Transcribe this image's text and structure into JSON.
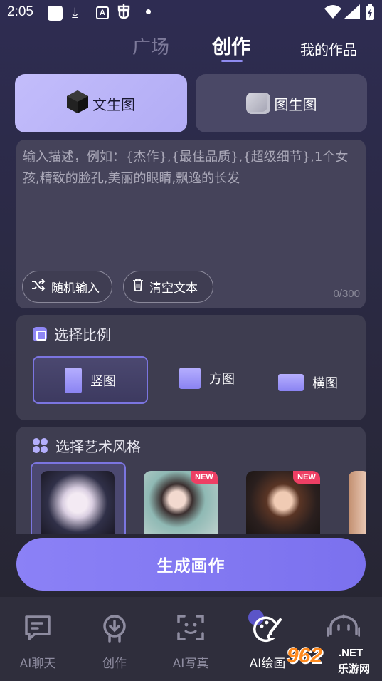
{
  "status_bar": {
    "time": "2:05",
    "icons": [
      "notification-square-icon",
      "download-icon",
      "a-icon",
      "bug-icon",
      "dot-icon",
      "wifi-icon",
      "signal-icon",
      "battery-icon"
    ]
  },
  "top_tabs": {
    "items": [
      {
        "label": "广场",
        "active": false
      },
      {
        "label": "创作",
        "active": true
      }
    ],
    "my_works": "我的作品"
  },
  "mode": {
    "text2img": {
      "label": "文生图",
      "icon": "cube-icon",
      "selected": true
    },
    "img2img": {
      "label": "图生图",
      "icon": "photo-icon",
      "selected": false
    }
  },
  "prompt": {
    "placeholder": "输入描述，例如：{杰作},{最佳品质},{超级细节},1个女孩,精致的脸孔,美丽的眼睛,飘逸的长发",
    "value": "",
    "char_count": "0/300",
    "random_label": "随机输入",
    "clear_label": "清空文本"
  },
  "ratio": {
    "title": "选择比例",
    "options": [
      {
        "label": "竖图",
        "selected": true
      },
      {
        "label": "方图",
        "selected": false
      },
      {
        "label": "横图",
        "selected": false
      }
    ]
  },
  "style": {
    "title": "选择艺术风格",
    "items": [
      {
        "badge": "",
        "selected": true
      },
      {
        "badge": "NEW",
        "selected": false
      },
      {
        "badge": "NEW",
        "selected": false
      },
      {
        "badge": "",
        "selected": false
      }
    ]
  },
  "generate_label": "生成画作",
  "bottom_nav": {
    "items": [
      {
        "label": "AI聊天",
        "icon": "chat-icon",
        "active": false
      },
      {
        "label": "创作",
        "icon": "create-icon",
        "active": false
      },
      {
        "label": "AI写真",
        "icon": "face-scan-icon",
        "active": false
      },
      {
        "label": "AI绘画",
        "icon": "paint-icon",
        "active": true
      },
      {
        "label": "",
        "icon": "robot-icon",
        "active": false
      }
    ]
  },
  "watermark": {
    "main": "962",
    "domain": ".NET",
    "sub": "乐游网"
  },
  "colors": {
    "accent": "#8b81f6",
    "selected_mode": "#c3bdfb",
    "new_badge": "#ee3f64"
  }
}
